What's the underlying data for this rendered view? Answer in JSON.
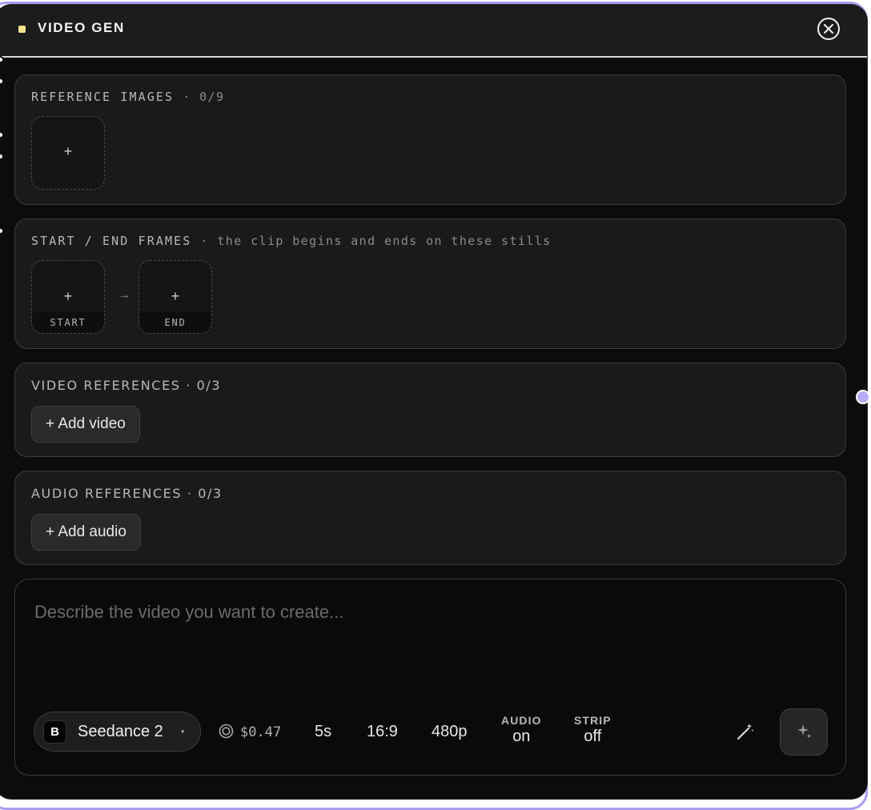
{
  "header": {
    "title": "VIDEO GEN",
    "accent_color": "#f3e38a",
    "close_icon": "close-icon"
  },
  "reference_images": {
    "label": "REFERENCE IMAGES",
    "count": "· 0/9",
    "add_symbol": "+"
  },
  "frames": {
    "label": "START / END FRAMES",
    "hint": "· the clip begins and ends on these stills",
    "start_symbol": "+",
    "start_label": "START",
    "arrow": "→",
    "end_symbol": "+",
    "end_label": "END"
  },
  "video_refs": {
    "label": "VIDEO REFERENCES",
    "count": "· 0/3",
    "button": "+ Add video"
  },
  "audio_refs": {
    "label": "AUDIO REFERENCES",
    "count": "· 0/3",
    "button": "+ Add audio"
  },
  "prompt": {
    "placeholder": "Describe the video you want to create...",
    "model_badge": "B",
    "model_name": "Seedance 2",
    "model_caret": "▾",
    "cost": "$0.47",
    "duration": "5s",
    "aspect": "16:9",
    "resolution": "480p",
    "audio_label": "AUDIO",
    "audio_value": "on",
    "strip_label": "STRIP",
    "strip_value": "off",
    "enhance_icon": "magic-wand-icon",
    "generate_icon": "sparkle-icon"
  },
  "colors": {
    "frame_accent": "#a99cf0",
    "panel_bg": "#0c0c0c",
    "section_bg": "#1a1a1a"
  }
}
